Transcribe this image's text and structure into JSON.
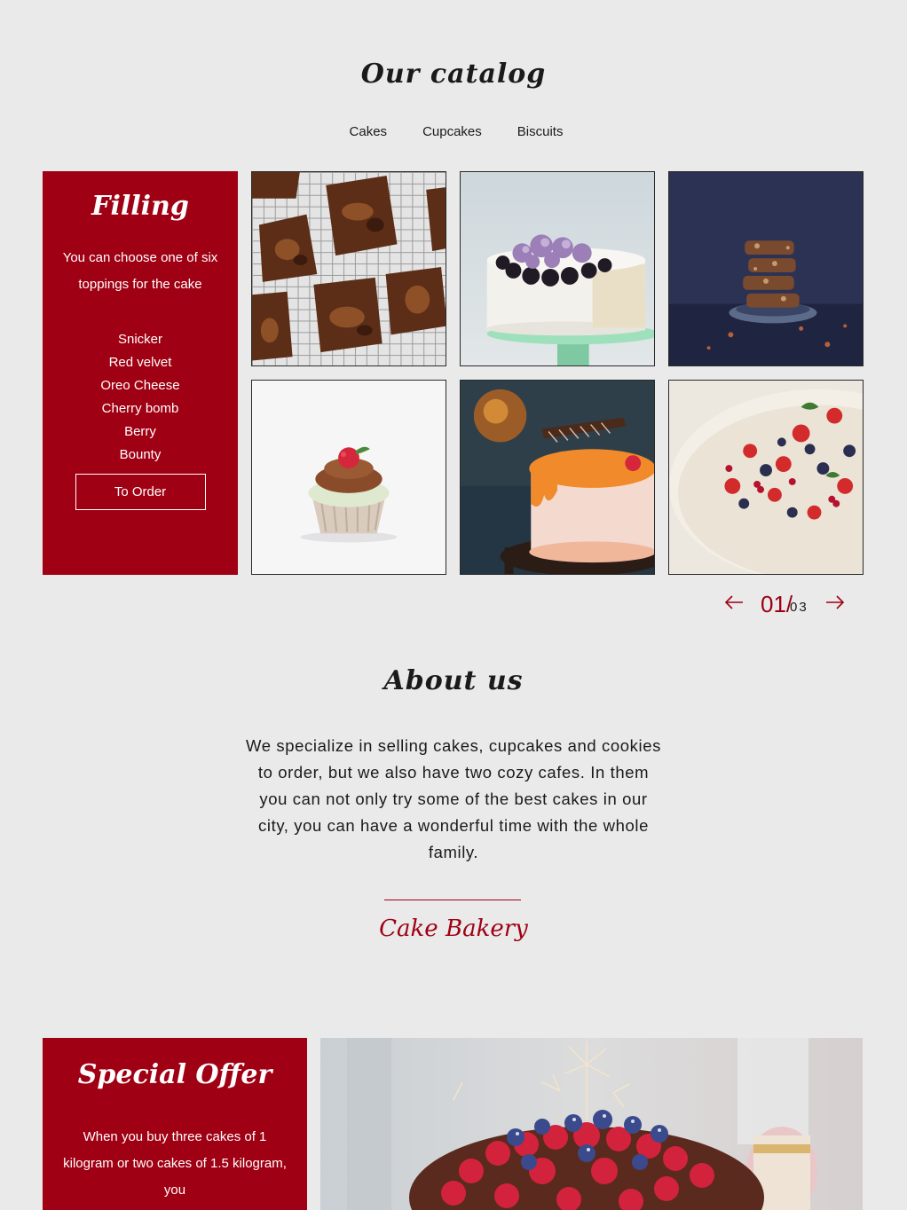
{
  "catalog": {
    "title": "Our catalog",
    "tabs": [
      "Cakes",
      "Cupcakes",
      "Biscuits"
    ]
  },
  "filling": {
    "title": "Filling",
    "description": "You can choose one of six toppings for the cake",
    "items": [
      "Snicker",
      "Red velvet",
      "Oreo Cheese",
      "Cherry bomb",
      "Berry",
      "Bounty"
    ],
    "order_label": "To Order"
  },
  "gallery": {
    "photos": [
      "brownies-photo",
      "blackberry-cake-photo",
      "cookie-stack-photo",
      "cupcake-photo",
      "orange-glaze-cake-photo",
      "berry-cheesecake-photo"
    ]
  },
  "pager": {
    "current": "01/",
    "total": "03",
    "prev_icon": "arrow-left-icon",
    "next_icon": "arrow-right-icon"
  },
  "about": {
    "title": "About us",
    "text": "We specialize in selling cakes, cupcakes and cookies to order, but we also have two cozy cafes. In them you can not only try some of the best cakes in our city, you can have a wonderful time with the whole family.",
    "signature": "Cake Bakery"
  },
  "offer": {
    "title": "Special Offer",
    "description": "When you buy three cakes of 1 kilogram or two cakes of 1.5 kilogram, you"
  },
  "colors": {
    "background": "#e9eae9",
    "accent": "#a00013",
    "text": "#141414"
  }
}
